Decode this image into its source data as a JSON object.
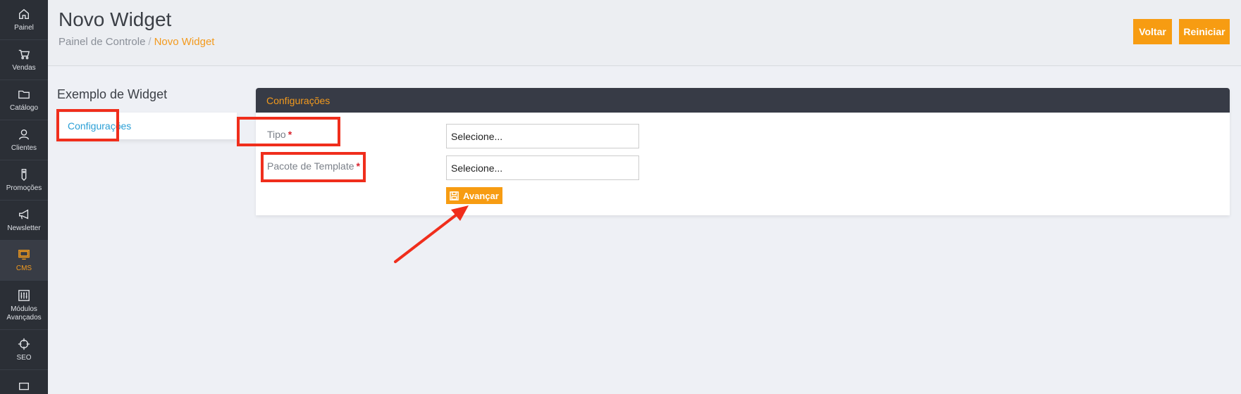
{
  "sidebar": {
    "items": [
      {
        "label": "Painel",
        "icon": "home-icon"
      },
      {
        "label": "Vendas",
        "icon": "cart-icon"
      },
      {
        "label": "Catálogo",
        "icon": "folder-icon"
      },
      {
        "label": "Clientes",
        "icon": "user-icon"
      },
      {
        "label": "Promoções",
        "icon": "tag-icon"
      },
      {
        "label": "Newsletter",
        "icon": "megaphone-icon"
      },
      {
        "label": "CMS",
        "icon": "monitor-icon"
      },
      {
        "label": "Módulos Avançados",
        "icon": "sliders-icon"
      },
      {
        "label": "SEO",
        "icon": "crosshair-icon"
      }
    ],
    "active": "CMS",
    "active_color": "#f39a1d"
  },
  "header": {
    "title": "Novo Widget",
    "breadcrumb": {
      "root": "Painel de Controle",
      "separator": "/",
      "current": "Novo Widget"
    },
    "buttons": {
      "back": "Voltar",
      "reset": "Reiniciar"
    }
  },
  "left_panel": {
    "title": "Exemplo de Widget",
    "tab": "Configurações"
  },
  "config_panel": {
    "title": "Configurações",
    "fields": [
      {
        "label": "Tipo",
        "required_mark": "*",
        "value": "Selecione..."
      },
      {
        "label": "Pacote de Template",
        "required_mark": "*",
        "value": "Selecione..."
      }
    ],
    "submit_label": "Avançar"
  },
  "colors": {
    "accent": "#f79c12",
    "sidebar_bg": "#2b2f36",
    "panel_header_bg": "#373b46",
    "link": "#2a9fd6",
    "annotation": "#f02e1c"
  }
}
